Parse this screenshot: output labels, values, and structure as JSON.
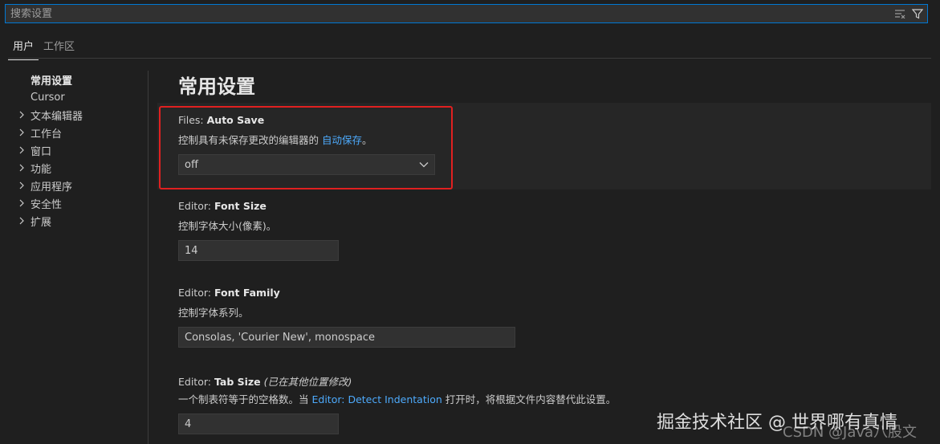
{
  "search": {
    "placeholder": "搜索设置"
  },
  "tabs": [
    {
      "label": "用户"
    },
    {
      "label": "工作区"
    }
  ],
  "sidebar": {
    "items": [
      {
        "label": "常用设置"
      },
      {
        "label": "Cursor"
      },
      {
        "label": "文本编辑器"
      },
      {
        "label": "工作台"
      },
      {
        "label": "窗口"
      },
      {
        "label": "功能"
      },
      {
        "label": "应用程序"
      },
      {
        "label": "安全性"
      },
      {
        "label": "扩展"
      }
    ]
  },
  "main": {
    "heading": "常用设置",
    "settings": [
      {
        "category": "Files: ",
        "name": "Auto Save",
        "desc_before": "控制具有未保存更改的编辑器的 ",
        "desc_link": "自动保存",
        "desc_after": "。",
        "value": "off"
      },
      {
        "category": "Editor: ",
        "name": "Font Size",
        "desc": "控制字体大小(像素)。",
        "value": "14"
      },
      {
        "category": "Editor: ",
        "name": "Font Family",
        "desc": "控制字体系列。",
        "value": "Consolas, 'Courier New', monospace"
      },
      {
        "category": "Editor: ",
        "name": "Tab Size",
        "modified": "(已在其他位置修改)",
        "desc_before": "一个制表符等于的空格数。当 ",
        "desc_link": "Editor: Detect Indentation",
        "desc_after": " 打开时，将根据文件内容替代此设置。",
        "value": "4"
      }
    ]
  },
  "watermark": {
    "main": "掘金技术社区 @ 世界哪有真情",
    "sub": "CSDN @Java八股文"
  }
}
